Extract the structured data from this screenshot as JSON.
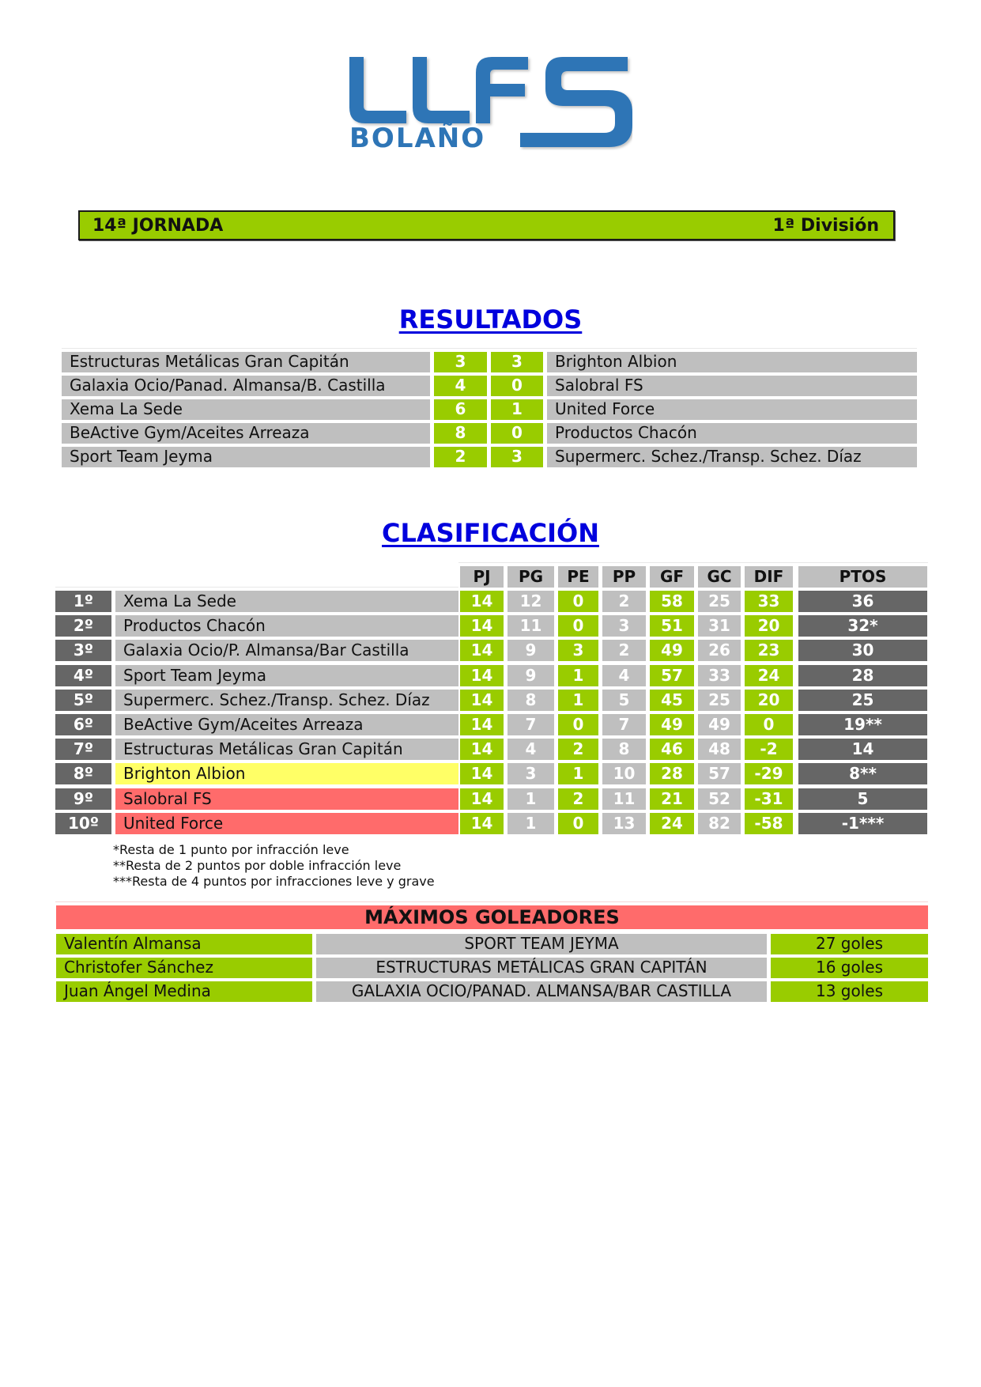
{
  "logo": {
    "line1": "LLF",
    "line2": "BOLAÑO",
    "big_letter": "S",
    "color": "#2e75b6"
  },
  "banner": {
    "jornada": "14ª JORNADA",
    "division": "1ª División"
  },
  "results": {
    "title": "RESULTADOS",
    "matches": [
      {
        "home": "Estructuras Metálicas Gran Capitán",
        "home_goals": "3",
        "away_goals": "3",
        "away": "Brighton Albion"
      },
      {
        "home": "Galaxia Ocio/Panad. Almansa/B. Castilla",
        "home_goals": "4",
        "away_goals": "0",
        "away": "Salobral FS"
      },
      {
        "home": "Xema La Sede",
        "home_goals": "6",
        "away_goals": "1",
        "away": "United Force"
      },
      {
        "home": "BeActive Gym/Aceites Arreaza",
        "home_goals": "8",
        "away_goals": "0",
        "away": "Productos Chacón"
      },
      {
        "home": "Sport Team Jeyma",
        "home_goals": "2",
        "away_goals": "3",
        "away": "Supermerc. Schez./Transp. Schez. Díaz"
      }
    ]
  },
  "standings": {
    "title": "CLASIFICACIÓN",
    "columns": [
      "PJ",
      "PG",
      "PE",
      "PP",
      "GF",
      "GC",
      "DIF",
      "PTOS"
    ],
    "rows": [
      {
        "pos": "1º",
        "team": "Xema La Sede",
        "status": "normal",
        "pj": "14",
        "pg": "12",
        "pe": "0",
        "pp": "2",
        "gf": "58",
        "gc": "25",
        "dif": "33",
        "ptos": "36"
      },
      {
        "pos": "2º",
        "team": "Productos Chacón",
        "status": "normal",
        "pj": "14",
        "pg": "11",
        "pe": "0",
        "pp": "3",
        "gf": "51",
        "gc": "31",
        "dif": "20",
        "ptos": "32*"
      },
      {
        "pos": "3º",
        "team": "Galaxia Ocio/P. Almansa/Bar Castilla",
        "status": "normal",
        "pj": "14",
        "pg": "9",
        "pe": "3",
        "pp": "2",
        "gf": "49",
        "gc": "26",
        "dif": "23",
        "ptos": "30"
      },
      {
        "pos": "4º",
        "team": "Sport Team Jeyma",
        "status": "normal",
        "pj": "14",
        "pg": "9",
        "pe": "1",
        "pp": "4",
        "gf": "57",
        "gc": "33",
        "dif": "24",
        "ptos": "28"
      },
      {
        "pos": "5º",
        "team": "Supermerc. Schez./Transp. Schez. Díaz",
        "status": "normal",
        "pj": "14",
        "pg": "8",
        "pe": "1",
        "pp": "5",
        "gf": "45",
        "gc": "25",
        "dif": "20",
        "ptos": "25"
      },
      {
        "pos": "6º",
        "team": "BeActive Gym/Aceites Arreaza",
        "status": "normal",
        "pj": "14",
        "pg": "7",
        "pe": "0",
        "pp": "7",
        "gf": "49",
        "gc": "49",
        "dif": "0",
        "ptos": "19**"
      },
      {
        "pos": "7º",
        "team": "Estructuras Metálicas Gran Capitán",
        "status": "normal",
        "pj": "14",
        "pg": "4",
        "pe": "2",
        "pp": "8",
        "gf": "46",
        "gc": "48",
        "dif": "-2",
        "ptos": "14"
      },
      {
        "pos": "8º",
        "team": "Brighton Albion",
        "status": "warning",
        "pj": "14",
        "pg": "3",
        "pe": "1",
        "pp": "10",
        "gf": "28",
        "gc": "57",
        "dif": "-29",
        "ptos": "8**"
      },
      {
        "pos": "9º",
        "team": "Salobral FS",
        "status": "relegation",
        "pj": "14",
        "pg": "1",
        "pe": "2",
        "pp": "11",
        "gf": "21",
        "gc": "52",
        "dif": "-31",
        "ptos": "5"
      },
      {
        "pos": "10º",
        "team": "United Force",
        "status": "relegation",
        "pj": "14",
        "pg": "1",
        "pe": "0",
        "pp": "13",
        "gf": "24",
        "gc": "82",
        "dif": "-58",
        "ptos": "-1***"
      }
    ],
    "notes": [
      "*Resta de 1 punto por infracción leve",
      "**Resta de 2 puntos por doble infracción leve",
      "***Resta de 4 puntos por infracciones leve y grave"
    ]
  },
  "scorers": {
    "title": "MÁXIMOS GOLEADORES",
    "rows": [
      {
        "player": "Valentín Almansa",
        "team": "SPORT TEAM JEYMA",
        "goals": "27 goles"
      },
      {
        "player": "Christofer Sánchez",
        "team": "ESTRUCTURAS METÁLICAS GRAN CAPITÁN",
        "goals": "16 goles"
      },
      {
        "player": "Juan Ángel Medina",
        "team": "GALAXIA OCIO/PANAD. ALMANSA/BAR CASTILLA",
        "goals": "13 goles"
      }
    ]
  },
  "colors": {
    "green": "#99cc00",
    "grey": "#bfbfbf",
    "dark": "#666666",
    "yellow": "#ffff66",
    "red": "#ff6b6b",
    "title_blue": "#0000dd"
  }
}
